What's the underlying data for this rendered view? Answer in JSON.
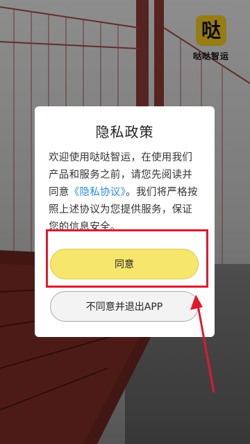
{
  "app": {
    "logo_glyph": "哒",
    "logo_name": "哒哒智运"
  },
  "dialog": {
    "title": "隐私政策",
    "body_before_link": "欢迎使用哒哒智运，在使用我们产品和服务之前，请您先阅读并同意",
    "link_text": "《隐私协议》",
    "body_after_link": "。我们将严格按照上述协议为您提供服务，保证您的信息安全。",
    "agree_label": "同意",
    "disagree_label": "不同意并退出APP"
  },
  "colors": {
    "accent_yellow": "#f6e66c",
    "logo_yellow": "#f2c81e",
    "link_blue": "#2a8be8",
    "annotation_red": "#e0192d"
  }
}
